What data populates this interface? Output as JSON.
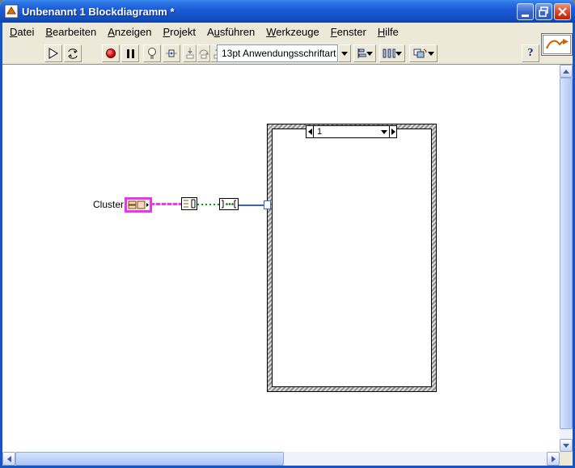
{
  "window": {
    "title": "Unbenannt 1 Blockdiagramm *"
  },
  "menu": {
    "items": [
      {
        "pre": "",
        "key": "D",
        "post": "atei"
      },
      {
        "pre": "",
        "key": "B",
        "post": "earbeiten"
      },
      {
        "pre": "",
        "key": "A",
        "post": "nzeigen"
      },
      {
        "pre": "",
        "key": "P",
        "post": "rojekt"
      },
      {
        "pre": "A",
        "key": "u",
        "post": "sführen"
      },
      {
        "pre": "",
        "key": "W",
        "post": "erkzeuge"
      },
      {
        "pre": "",
        "key": "F",
        "post": "enster"
      },
      {
        "pre": "",
        "key": "H",
        "post": "ilfe"
      }
    ]
  },
  "toolbar": {
    "font_selector": "13pt Anwendungsschriftart",
    "help_label": "?"
  },
  "diagram": {
    "cluster_label": "Cluster",
    "sequence_selector": "1"
  },
  "icons": {
    "run-icon": "hollow right arrow",
    "run-continuous-icon": "circular arrows",
    "abort-icon": "red circle",
    "pause-icon": "pause bars",
    "highlight-execution-icon": "lightbulb",
    "retain-wire-values-icon": "wire with probe",
    "step-into-icon": "arrow into box",
    "step-over-icon": "arrow over box",
    "step-out-icon": "arrow out of box",
    "dropdown-icon": "▼",
    "decrement-icon": "◄",
    "increment-icon": "►",
    "scroll-up-icon": "▲",
    "scroll-down-icon": "▼",
    "scroll-left-icon": "◄",
    "scroll-right-icon": "►"
  },
  "colors": {
    "titlebar": "#1C5CD8",
    "chrome": "#ECE9D8",
    "cluster_wire": "#EA3BEA",
    "bool_wire": "#00A200",
    "int_wire": "#3064C8",
    "structure_border_dark": "#8C8C8C",
    "structure_border_light": "#DCDCDC"
  }
}
